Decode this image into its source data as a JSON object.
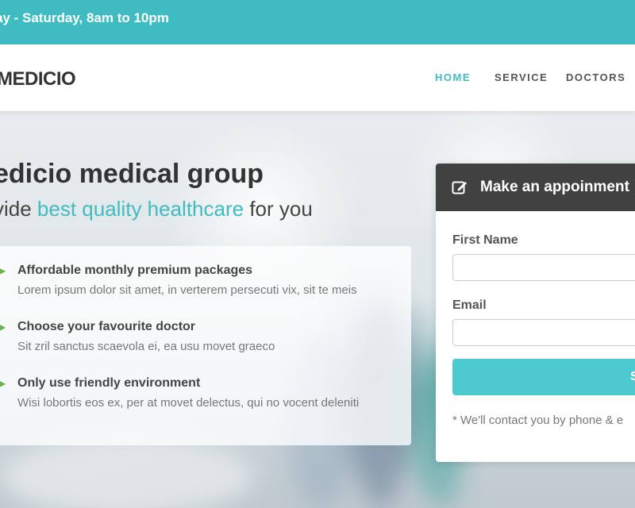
{
  "topbar": {
    "hours": "ay - Saturday, 8am to 10pm"
  },
  "brand": {
    "logo": "MEDICIO",
    "accent_color": "#3fbcc2"
  },
  "nav": {
    "items": [
      {
        "label": "HOME",
        "active": true
      },
      {
        "label": "SERVICE",
        "active": false
      },
      {
        "label": "DOCTORS",
        "active": false
      }
    ]
  },
  "hero": {
    "title": "edicio medical group",
    "subtitle_prefix": "vide ",
    "subtitle_accent": "best quality healthcare",
    "subtitle_suffix": " for you",
    "features": [
      {
        "title": "Affordable monthly premium packages",
        "desc": "Lorem ipsum dolor sit amet, in verterem persecuti vix, sit te meis"
      },
      {
        "title": "Choose your favourite doctor",
        "desc": "Sit zril sanctus scaevola ei, ea usu movet graeco"
      },
      {
        "title": "Only use friendly environment",
        "desc": "Wisi lobortis eos ex, per at movet delectus, qui no vocent deleniti"
      }
    ]
  },
  "appointment": {
    "heading": "Make an appoinment",
    "first_name_label": "First Name",
    "first_name_value": "",
    "email_label": "Email",
    "email_value": "",
    "submit_label": "S",
    "note": "* We'll contact you by phone & e"
  }
}
